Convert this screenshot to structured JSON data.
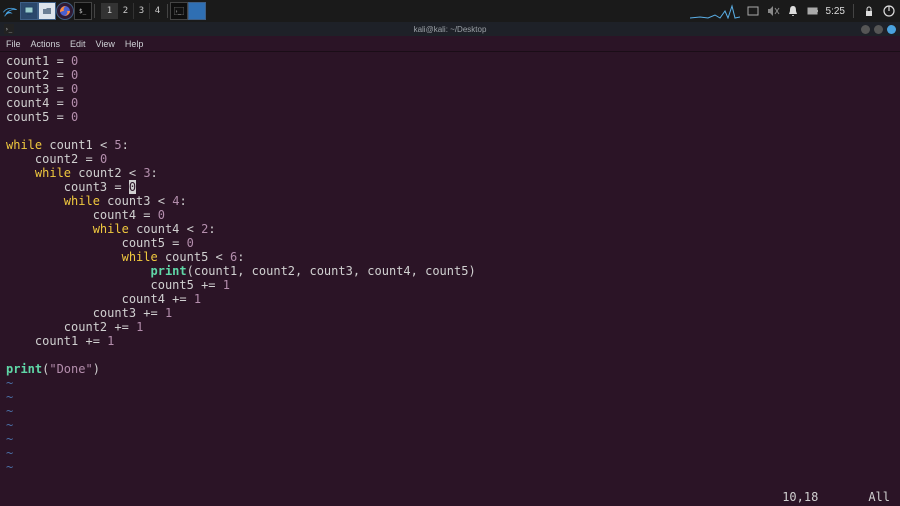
{
  "taskbar": {
    "workspaces": [
      "1",
      "2",
      "3",
      "4"
    ],
    "active_workspace": 0,
    "clock": "5:25",
    "icons": {
      "kali": "kali-logo",
      "apps": [
        "monitor",
        "files",
        "firefox",
        "terminal"
      ],
      "running": [
        "terminal",
        "panel"
      ],
      "tray": [
        "window",
        "volume-mute",
        "notification",
        "battery",
        "lock",
        "logout"
      ]
    }
  },
  "window": {
    "title": "kali@kali: ~/Desktop",
    "menus": [
      "File",
      "Actions",
      "Edit",
      "View",
      "Help"
    ]
  },
  "code": {
    "lines": [
      [
        [
          "ident",
          "count1"
        ],
        [
          "op",
          " = "
        ],
        [
          "num",
          "0"
        ]
      ],
      [
        [
          "ident",
          "count2"
        ],
        [
          "op",
          " = "
        ],
        [
          "num",
          "0"
        ]
      ],
      [
        [
          "ident",
          "count3"
        ],
        [
          "op",
          " = "
        ],
        [
          "num",
          "0"
        ]
      ],
      [
        [
          "ident",
          "count4"
        ],
        [
          "op",
          " = "
        ],
        [
          "num",
          "0"
        ]
      ],
      [
        [
          "ident",
          "count5"
        ],
        [
          "op",
          " = "
        ],
        [
          "num",
          "0"
        ]
      ],
      [],
      [
        [
          "kw",
          "while"
        ],
        [
          "op",
          " "
        ],
        [
          "ident",
          "count1"
        ],
        [
          "op",
          " < "
        ],
        [
          "num",
          "5"
        ],
        [
          "op",
          ":"
        ]
      ],
      [
        [
          "op",
          "    "
        ],
        [
          "ident",
          "count2"
        ],
        [
          "op",
          " = "
        ],
        [
          "num",
          "0"
        ]
      ],
      [
        [
          "op",
          "    "
        ],
        [
          "kw",
          "while"
        ],
        [
          "op",
          " "
        ],
        [
          "ident",
          "count2"
        ],
        [
          "op",
          " < "
        ],
        [
          "num",
          "3"
        ],
        [
          "op",
          ":"
        ]
      ],
      [
        [
          "op",
          "        "
        ],
        [
          "ident",
          "count3"
        ],
        [
          "op",
          " = "
        ],
        [
          "cursor",
          "0"
        ]
      ],
      [
        [
          "op",
          "        "
        ],
        [
          "kw",
          "while"
        ],
        [
          "op",
          " "
        ],
        [
          "ident",
          "count3"
        ],
        [
          "op",
          " < "
        ],
        [
          "num",
          "4"
        ],
        [
          "op",
          ":"
        ]
      ],
      [
        [
          "op",
          "            "
        ],
        [
          "ident",
          "count4"
        ],
        [
          "op",
          " = "
        ],
        [
          "num",
          "0"
        ]
      ],
      [
        [
          "op",
          "            "
        ],
        [
          "kw",
          "while"
        ],
        [
          "op",
          " "
        ],
        [
          "ident",
          "count4"
        ],
        [
          "op",
          " < "
        ],
        [
          "num",
          "2"
        ],
        [
          "op",
          ":"
        ]
      ],
      [
        [
          "op",
          "                "
        ],
        [
          "ident",
          "count5"
        ],
        [
          "op",
          " = "
        ],
        [
          "num",
          "0"
        ]
      ],
      [
        [
          "op",
          "                "
        ],
        [
          "kw",
          "while"
        ],
        [
          "op",
          " "
        ],
        [
          "ident",
          "count5"
        ],
        [
          "op",
          " < "
        ],
        [
          "num",
          "6"
        ],
        [
          "op",
          ":"
        ]
      ],
      [
        [
          "op",
          "                    "
        ],
        [
          "fn",
          "print"
        ],
        [
          "op",
          "("
        ],
        [
          "ident",
          "count1"
        ],
        [
          "op",
          ", "
        ],
        [
          "ident",
          "count2"
        ],
        [
          "op",
          ", "
        ],
        [
          "ident",
          "count3"
        ],
        [
          "op",
          ", "
        ],
        [
          "ident",
          "count4"
        ],
        [
          "op",
          ", "
        ],
        [
          "ident",
          "count5"
        ],
        [
          "op",
          ")"
        ]
      ],
      [
        [
          "op",
          "                    "
        ],
        [
          "ident",
          "count5"
        ],
        [
          "op",
          " += "
        ],
        [
          "num",
          "1"
        ]
      ],
      [
        [
          "op",
          "                "
        ],
        [
          "ident",
          "count4"
        ],
        [
          "op",
          " += "
        ],
        [
          "num",
          "1"
        ]
      ],
      [
        [
          "op",
          "            "
        ],
        [
          "ident",
          "count3"
        ],
        [
          "op",
          " += "
        ],
        [
          "num",
          "1"
        ]
      ],
      [
        [
          "op",
          "        "
        ],
        [
          "ident",
          "count2"
        ],
        [
          "op",
          " += "
        ],
        [
          "num",
          "1"
        ]
      ],
      [
        [
          "op",
          "    "
        ],
        [
          "ident",
          "count1"
        ],
        [
          "op",
          " += "
        ],
        [
          "num",
          "1"
        ]
      ],
      [],
      [
        [
          "fn",
          "print"
        ],
        [
          "op",
          "("
        ],
        [
          "str",
          "\"Done\""
        ],
        [
          "op",
          ")"
        ]
      ]
    ],
    "tildes": 7
  },
  "status": {
    "position": "10,18",
    "scroll": "All"
  }
}
